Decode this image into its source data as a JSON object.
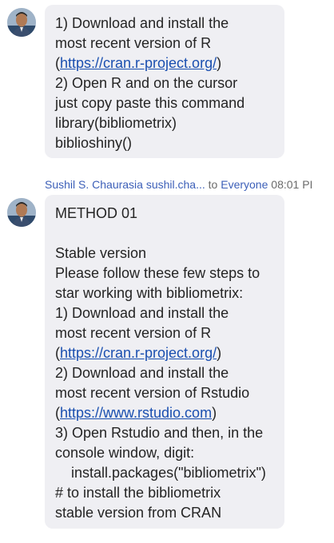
{
  "message1": {
    "lines": [
      {
        "type": "text",
        "text": "1)         Download and install the"
      },
      {
        "type": "text",
        "text": "most recent version of R"
      },
      {
        "type": "link",
        "pre": "(",
        "link": "https://cran.r-project.org/",
        "post": ")"
      },
      {
        "type": "text",
        "text": "2)         Open R and on the cursor"
      },
      {
        "type": "text",
        "text": "just copy paste this command"
      },
      {
        "type": "text",
        "text": "library(bibliometrix)"
      },
      {
        "type": "text",
        "text": "biblioshiny()"
      }
    ]
  },
  "message2": {
    "header": {
      "sender": "Sushil S. Chaurasia sushil.cha...",
      "to_label": "to",
      "to_target": "Everyone",
      "time": "08:01 PI"
    },
    "lines": [
      {
        "type": "text",
        "text": "METHOD 01"
      },
      {
        "type": "blank",
        "text": ""
      },
      {
        "type": "text",
        "text": "Stable version"
      },
      {
        "type": "text",
        "text": "Please follow these few steps to"
      },
      {
        "type": "text",
        "text": "star working with bibliometrix:"
      },
      {
        "type": "text",
        "text": "1) Download and install the"
      },
      {
        "type": "text",
        "text": "most recent version of R"
      },
      {
        "type": "link",
        "pre": "(",
        "link": "https://cran.r-project.org/",
        "post": ")"
      },
      {
        "type": "text",
        "text": "2) Download and install the"
      },
      {
        "type": "text",
        "text": "most recent version of Rstudio"
      },
      {
        "type": "link",
        "pre": "(",
        "link": "https://www.rstudio.com",
        "post": ")"
      },
      {
        "type": "text",
        "text": "3) Open Rstudio and then, in the"
      },
      {
        "type": "text",
        "text": "console window, digit:"
      },
      {
        "type": "text",
        "text": "    install.packages(\"bibliometrix\")"
      },
      {
        "type": "text",
        "text": "# to install the bibliometrix"
      },
      {
        "type": "text",
        "text": "stable version from CRAN"
      }
    ]
  },
  "colors": {
    "bubble": "#efeff3",
    "link": "#1a4fb0",
    "sender": "#3c5fb8",
    "meta": "#6b6b6b"
  },
  "icons": {
    "avatar": "avatar-photo"
  }
}
